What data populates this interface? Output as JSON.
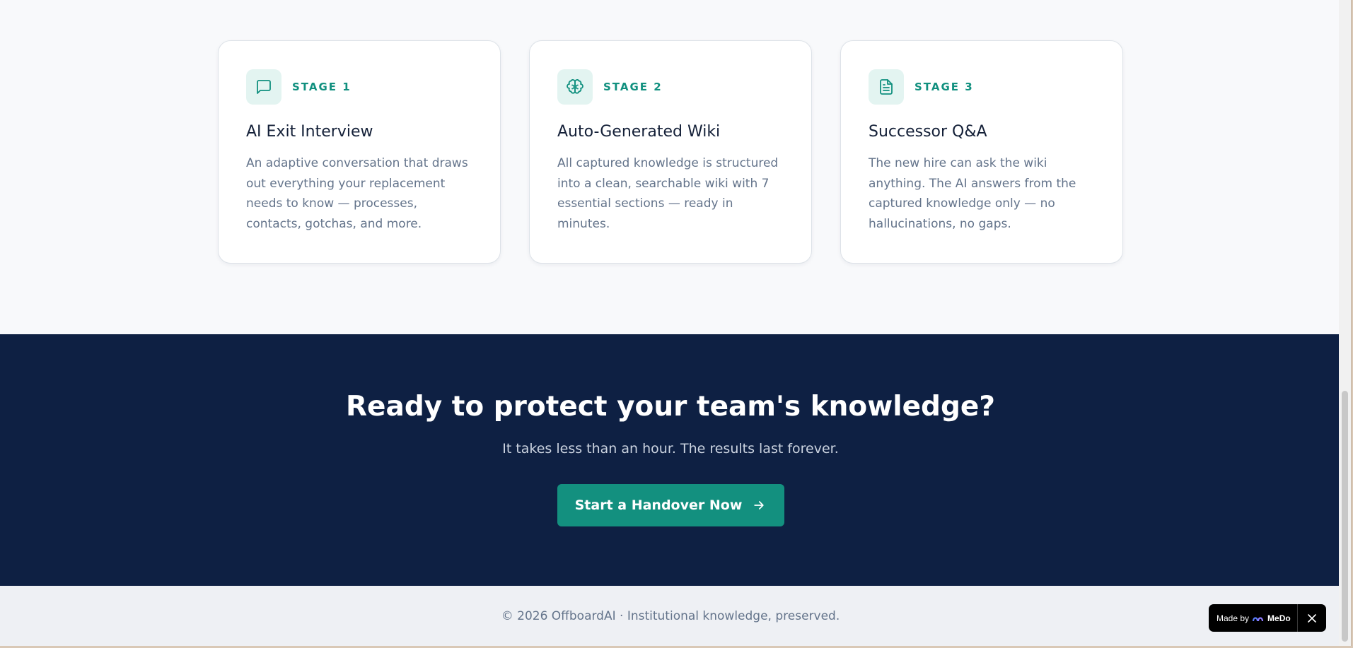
{
  "stages": [
    {
      "icon": "message-square-icon",
      "label": "STAGE 1",
      "title": "AI Exit Interview",
      "description": "An adaptive conversation that draws out everything your replacement needs to know — processes, contacts, gotchas, and more."
    },
    {
      "icon": "brain-icon",
      "label": "STAGE 2",
      "title": "Auto-Generated Wiki",
      "description": "All captured knowledge is structured into a clean, searchable wiki with 7 essential sections — ready in minutes."
    },
    {
      "icon": "document-icon",
      "label": "STAGE 3",
      "title": "Successor Q&A",
      "description": "The new hire can ask the wiki anything. The AI answers from the captured knowledge only — no hallucinations, no gaps."
    }
  ],
  "cta": {
    "title": "Ready to protect your team's knowledge?",
    "subtitle": "It takes less than an hour. The results last forever.",
    "button_label": "Start a Handover Now",
    "button_icon": "arrow-right-icon"
  },
  "footer": {
    "text": "© 2026 OffboardAI · Institutional knowledge, preserved."
  },
  "badge": {
    "prefix": "Made by",
    "brand": "MeDo",
    "close_icon": "close-icon"
  },
  "colors": {
    "accent": "#13907f",
    "navy": "#0e2043",
    "page_bg": "#f8f9fb"
  }
}
